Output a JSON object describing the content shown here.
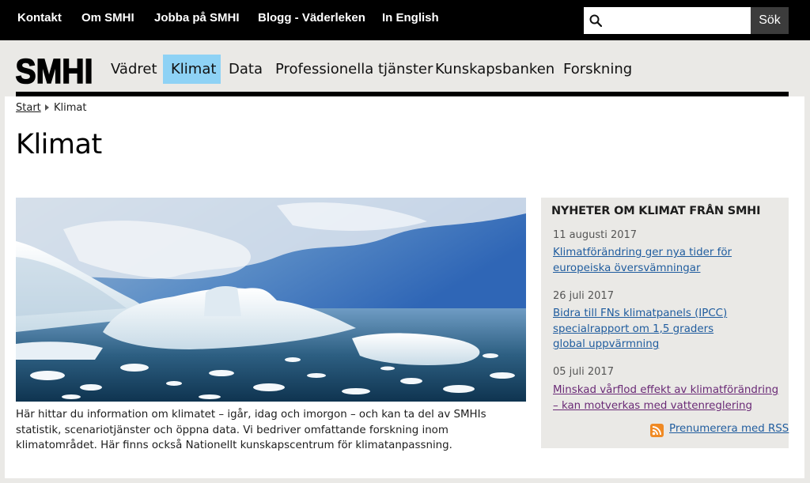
{
  "topbar": {
    "links": [
      "Kontakt",
      "Om SMHI",
      "Jobba på SMHI",
      "Blogg - Väderleken",
      "In English"
    ],
    "search": {
      "placeholder": "",
      "button_label": "Sök"
    }
  },
  "brand": {
    "logo_text": "SMHI"
  },
  "main_nav": {
    "items": [
      "Vädret",
      "Klimat",
      "Data",
      "Professionella tjänster",
      "Kunskapsbanken",
      "Forskning"
    ],
    "active": "Klimat"
  },
  "breadcrumb": {
    "items": [
      "Start",
      "Klimat"
    ]
  },
  "page": {
    "title": "Klimat",
    "intro": "Här hittar du information om klimatet – igår, idag och imorgon – och kan ta del av SMHIs statistik, scenariotjänster och öppna data. Vi bedriver omfattande forskning inom klimatområdet. Här finns också Nationellt kunskapscentrum för klimatanpassning."
  },
  "news": {
    "heading": "NYHETER OM KLIMAT FRÅN SMHI",
    "items": [
      {
        "date": "11 augusti 2017",
        "title": "Klimatförändring ger nya tider för europeiska översvämningar"
      },
      {
        "date": "26 juli 2017",
        "title": "Bidra till FNs klimatpanels (IPCC) specialrapport om 1,5 graders global uppvärmning"
      },
      {
        "date": "05 juli 2017",
        "title": "Minskad vårflod effekt av klimatförändring – kan motverkas med vattenreglering"
      }
    ],
    "rss_label": "Prenumerera med RSS"
  },
  "colors": {
    "topbar_bg": "#000000",
    "active_nav_bg": "#8ed2f5",
    "link": "#1f5c9e",
    "visited_link": "#6a2a76",
    "news_bg": "#eae9e6",
    "rss_orange": "#f08a24"
  },
  "icons": {
    "search": "magnifier-icon",
    "rss": "rss-icon",
    "breadcrumb_separator": "triangle-right-icon"
  }
}
